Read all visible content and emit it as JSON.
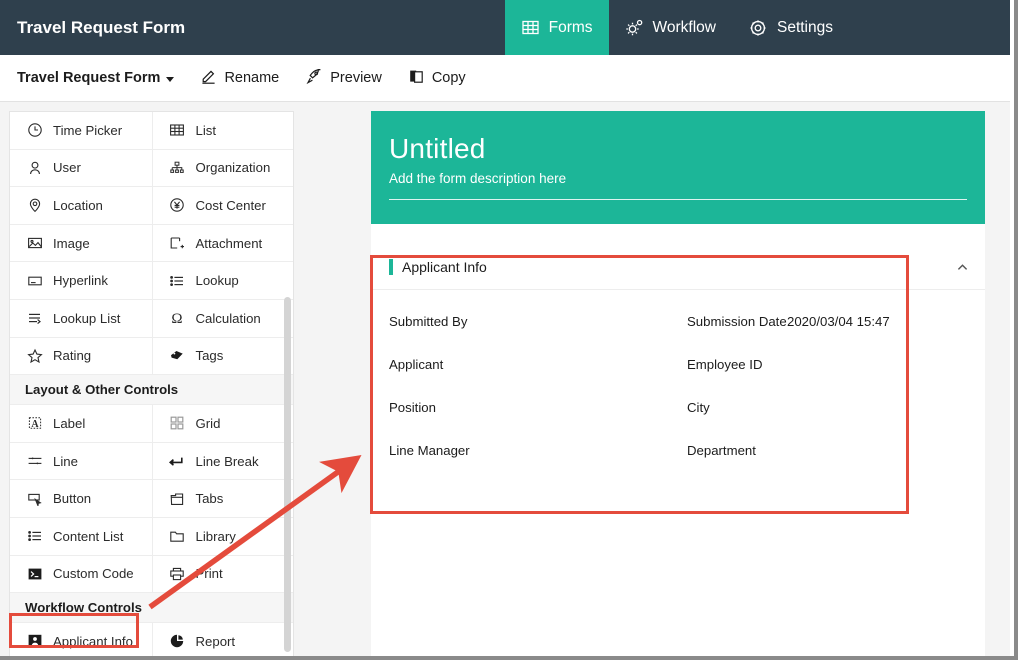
{
  "topbar": {
    "title": "Travel Request Form",
    "tabs": [
      {
        "label": "Forms",
        "icon": "grid-icon",
        "active": true
      },
      {
        "label": "Workflow",
        "icon": "workflow-gear-icon",
        "active": false
      },
      {
        "label": "Settings",
        "icon": "gear-icon",
        "active": false
      }
    ]
  },
  "toolbar": {
    "form_name": "Travel Request Form",
    "actions": [
      {
        "label": "Rename",
        "icon": "pencil-icon"
      },
      {
        "label": "Preview",
        "icon": "rocket-icon"
      },
      {
        "label": "Copy",
        "icon": "copy-icon"
      }
    ]
  },
  "sidebar": {
    "rows_top": [
      [
        {
          "label": "Time Picker",
          "icon": "clock-icon"
        },
        {
          "label": "List",
          "icon": "table-grid-icon"
        }
      ],
      [
        {
          "label": "User",
          "icon": "user-icon"
        },
        {
          "label": "Organization",
          "icon": "org-chart-icon"
        }
      ],
      [
        {
          "label": "Location",
          "icon": "map-pin-icon"
        },
        {
          "label": "Cost Center",
          "icon": "yen-circle-icon"
        }
      ],
      [
        {
          "label": "Image",
          "icon": "image-icon"
        },
        {
          "label": "Attachment",
          "icon": "attachment-add-icon"
        }
      ],
      [
        {
          "label": "Hyperlink",
          "icon": "hyperlink-icon"
        },
        {
          "label": "Lookup",
          "icon": "list-bullet-icon"
        }
      ],
      [
        {
          "label": "Lookup List",
          "icon": "lookup-list-icon"
        },
        {
          "label": "Calculation",
          "icon": "omega-icon"
        }
      ],
      [
        {
          "label": "Rating",
          "icon": "star-icon"
        },
        {
          "label": "Tags",
          "icon": "tag-icon"
        }
      ]
    ],
    "section_layout": "Layout & Other Controls",
    "rows_layout": [
      [
        {
          "label": "Label",
          "icon": "label-a-icon"
        },
        {
          "label": "Grid",
          "icon": "grid-four-icon"
        }
      ],
      [
        {
          "label": "Line",
          "icon": "line-icon"
        },
        {
          "label": "Line Break",
          "icon": "line-break-icon"
        }
      ],
      [
        {
          "label": "Button",
          "icon": "button-cursor-icon"
        },
        {
          "label": "Tabs",
          "icon": "tabs-icon"
        }
      ],
      [
        {
          "label": "Content List",
          "icon": "content-list-icon"
        },
        {
          "label": "Library",
          "icon": "folder-icon"
        }
      ],
      [
        {
          "label": "Custom Code",
          "icon": "terminal-icon"
        },
        {
          "label": "Print",
          "icon": "printer-icon"
        }
      ]
    ],
    "section_workflow": "Workflow Controls",
    "rows_workflow": [
      [
        {
          "label": "Applicant Info",
          "icon": "applicant-info-icon"
        },
        {
          "label": "Report",
          "icon": "pie-chart-icon"
        }
      ]
    ]
  },
  "preview": {
    "hero_title": "Untitled",
    "hero_description": "Add the form description here",
    "section": {
      "title": "Applicant Info",
      "collapse_icon": "chevron-up-icon",
      "rows": [
        {
          "left_label": "Submitted By",
          "left_value": "",
          "right_label": "Submission Date",
          "right_value": "2020/03/04 15:47"
        },
        {
          "left_label": "Applicant",
          "left_value": "",
          "right_label": "Employee ID",
          "right_value": ""
        },
        {
          "left_label": "Position",
          "left_value": "",
          "right_label": "City",
          "right_value": ""
        },
        {
          "left_label": "Line Manager",
          "left_value": "",
          "right_label": "Department",
          "right_value": ""
        }
      ]
    }
  },
  "colors": {
    "topbar": "#2f404d",
    "accent_green": "#1cb698",
    "annotation_red": "#e44b3c",
    "workarea": "#f4f4f4"
  }
}
